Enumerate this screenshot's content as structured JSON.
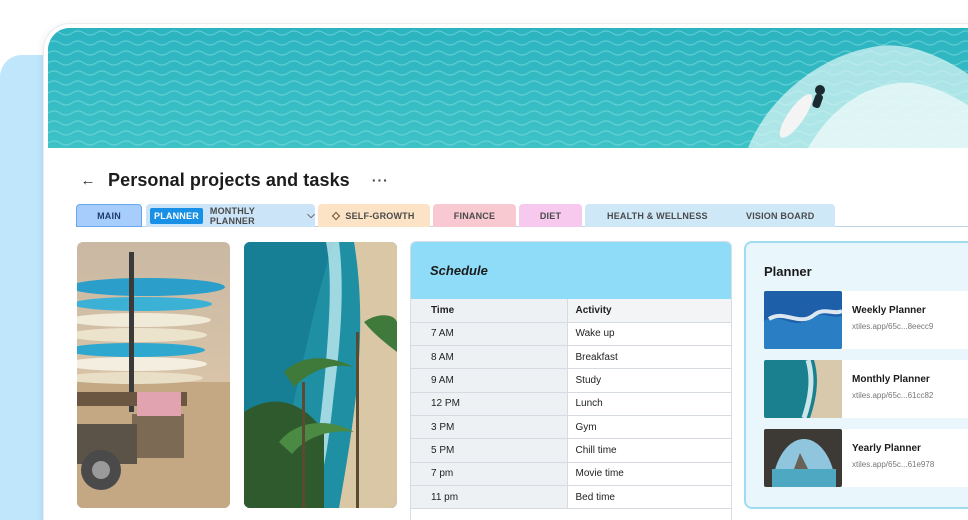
{
  "header": {
    "title": "Personal projects and tasks",
    "back_icon": "arrow-left-icon",
    "more_icon": "ellipsis-icon"
  },
  "tabs": {
    "main": "MAIN",
    "planner_badge": "PLANNER",
    "planner_sub": "MONTHLY PLANNER",
    "self_growth": "SELF-GROWTH",
    "finance": "FINANCE",
    "diet": "DIET",
    "health": "HEALTH & WELLNESS",
    "vision": "VISION BOARD"
  },
  "schedule": {
    "title": "Schedule",
    "columns": [
      "Time",
      "Activity"
    ],
    "rows": [
      [
        "7 AM",
        "Wake up"
      ],
      [
        "8 AM",
        "Breakfast"
      ],
      [
        "9 AM",
        "Study"
      ],
      [
        "12 PM",
        "Lunch"
      ],
      [
        "3 PM",
        "Gym"
      ],
      [
        "5 PM",
        "Chill time"
      ],
      [
        "7 pm",
        "Movie time"
      ],
      [
        "11 pm",
        "Bed time"
      ]
    ]
  },
  "planner": {
    "title": "Planner",
    "cards": [
      {
        "name": "Weekly Planner",
        "url": "xtiles.app/65c...8eecc9"
      },
      {
        "name": "Monthly Planner",
        "url": "xtiles.app/65c...61cc82"
      },
      {
        "name": "Yearly Planner",
        "url": "xtiles.app/65c...61e978"
      }
    ]
  },
  "colors": {
    "accent": "#1890e6",
    "schedule_header": "#8fdcf8",
    "tab_main": "#a6cdfb",
    "tab_self_growth": "#fde3c6",
    "tab_finance": "#f8c9d1",
    "tab_diet": "#f7c9ee",
    "tab_health": "#cfe8f8"
  }
}
